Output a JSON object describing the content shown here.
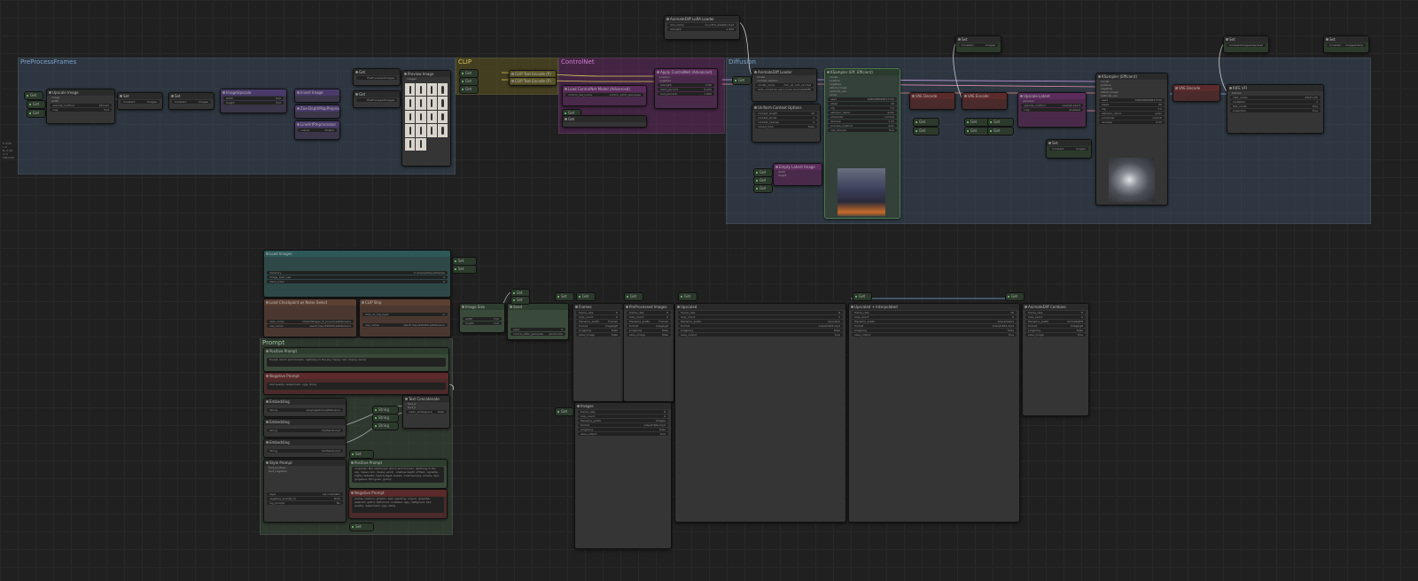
{
  "colors": {
    "background": "#202020",
    "group_blue": "#3a4a5c",
    "group_yellow": "#5c5422",
    "group_pink": "#5c2a5c",
    "group_green": "#3a4a3a"
  },
  "side_info": "T: 0.00\nI: 0\nN: 0 [0]\nV: 0\nFPS:0.00",
  "groups": {
    "preprocess": {
      "title": "PreProcessFrames"
    },
    "clip": {
      "title": "CLIP"
    },
    "controlnet": {
      "title": "ControlNet"
    },
    "diffusion": {
      "title": "Diffusion"
    },
    "prompt": {
      "title": "Prompt"
    }
  },
  "nodes": {
    "upscale_image": {
      "title": "Upscale Image",
      "w1": "bilinear",
      "w2": "512"
    },
    "set1": {
      "title": "Set",
      "w": "Images"
    },
    "set2": {
      "title": "Set",
      "w": "Images"
    },
    "image_crop": {
      "title": "ImageUpscale"
    },
    "invert_image": {
      "title": "Invert Image"
    },
    "zoe_depth": {
      "title": "Zoe-DepthMapPreprocessor"
    },
    "lineart": {
      "title": "LineArtPreprocessor",
      "w": "disable"
    },
    "preview_image": {
      "title": "Preview Image",
      "images_label": "images"
    },
    "get_pre1": {
      "title": "Get",
      "w": "PreProcessedImages"
    },
    "get_pre2": {
      "title": "Get",
      "w": "PreProcessedImages"
    },
    "clip_pos": {
      "title": "CLIP Text Encode (P)"
    },
    "clip_neg": {
      "title": "CLIP Text Encode (P)"
    },
    "load_controlnet": {
      "title": "Load ControlNet Model (Advanced)",
      "w": "control_sd15_openpose"
    },
    "apply_controlnet": {
      "title": "Apply ControlNet (Advanced)",
      "strength": "0.80",
      "start": "0.000",
      "end": "1.000"
    },
    "animatediff_lora": {
      "title": "AnimateDiff LoRA Loader",
      "w1": "v3_sd15_adapter.ckpt",
      "w2": "1.000"
    },
    "animatediff_loader": {
      "title": "AnimateDiff Loader",
      "w1": "mm_sd_v15_v2.ckpt",
      "w2": "sqrt_linear (AnimateDiff)"
    },
    "uniform_context": {
      "title": "Uniform Context Options"
    },
    "ksampler1": {
      "title": "KSampler (Eff. Efficient)",
      "seed": "1080288049617720",
      "steps": "20",
      "cfg": "7.0",
      "sampler": "euler",
      "scheduler": "normal",
      "denoise": "1.00"
    },
    "empty_latent": {
      "title": "Empty Latent Image"
    },
    "vae_decode1": {
      "title": "VAE Decode"
    },
    "vae_encode": {
      "title": "VAE Encode"
    },
    "upscale_latent": {
      "title": "Upscale Latent",
      "w1": "nearest-exact",
      "w2": "disabled"
    },
    "ksampler2": {
      "title": "KSampler (Efficient)",
      "seed": "1080288049617720",
      "steps": "20",
      "cfg": "7.0",
      "sampler": "euler",
      "scheduler": "normal",
      "denoise": "0.55"
    },
    "vae_decode2": {
      "title": "VAE Decode"
    },
    "rife_vfi": {
      "title": "RIFE VFI",
      "w1": "rife47.pth",
      "w2": "2"
    },
    "set_upscaled": {
      "title": "Set",
      "w": "Images"
    },
    "set_upscaled2": {
      "title": "Set",
      "w": "ImagesUpscaled"
    },
    "set_interp": {
      "title": "Set",
      "w": "ImagesInterp"
    },
    "load_images": {
      "title": "Load Images",
      "path": "C:/Users/Videos/frames",
      "w2": "0",
      "w3": "0"
    },
    "load_checkpoint": {
      "title": "Load Checkpoint w/ Noise Select",
      "w1": "DreamShaper_8_pruned.safetensors",
      "w2": "vae-ft-mse-840000.safetensors"
    },
    "clip_skip": {
      "title": "CLIP Skip",
      "w1": "-2",
      "w2": "vae-ft-mse-840000.safetensors"
    },
    "positive_prompt": {
      "title": "Positive Prompt",
      "text": "Forest, storm and tornado, lightning in the sky, heavy rain, (heavy wind)"
    },
    "negative_prompt": {
      "title": "Negative Prompt",
      "text": "bad quality, watermark, ugly, tiling"
    },
    "embedding1": {
      "title": "Embedding",
      "w": "easynegative.safetensors"
    },
    "embedding2": {
      "title": "Embedding",
      "w": "badhandv4.pt"
    },
    "embedding3": {
      "title": "Embedding",
      "w": "badhandv4.pt"
    },
    "text_concat": {
      "title": "Text Concatenate",
      "w": "false"
    },
    "style_prompt": {
      "title": "Style Prompt"
    },
    "positive_prompt2": {
      "title": "Positive Prompt",
      "text": "cinematic film still forest, storm and tornado, lightning in the sky, heavy rain, (heavy wind) . shallow depth of field, vignette, highly detailed, high budget, bokeh, cinemascope, moody, epic, gorgeous, film grain, grainy"
    },
    "negative_prompt2": {
      "title": "Negative Prompt",
      "text": "anime, cartoon, graphic, text, painting, crayon, graphite, abstract, glitch, deformed, mutated, ugly, disfigured, bad quality, watermark, ugly, tiling"
    },
    "image_size": {
      "title": "Image Size",
      "w1": "512",
      "w2": "512"
    },
    "seed_node": {
      "title": "Seed",
      "w": "randomize"
    },
    "frames_node": {
      "title": "Frames"
    },
    "preprocessed_images": {
      "title": "PreProcessed Images"
    },
    "upscaled_node": {
      "title": "Upscaled"
    },
    "upscaled_interp": {
      "title": "Upscaled + Interpolated"
    },
    "animatediff_combine": {
      "title": "AnimateDiff Combine"
    },
    "images_node": {
      "title": "Images"
    }
  },
  "getset_labels": {
    "get": "Get",
    "set": "Set"
  }
}
